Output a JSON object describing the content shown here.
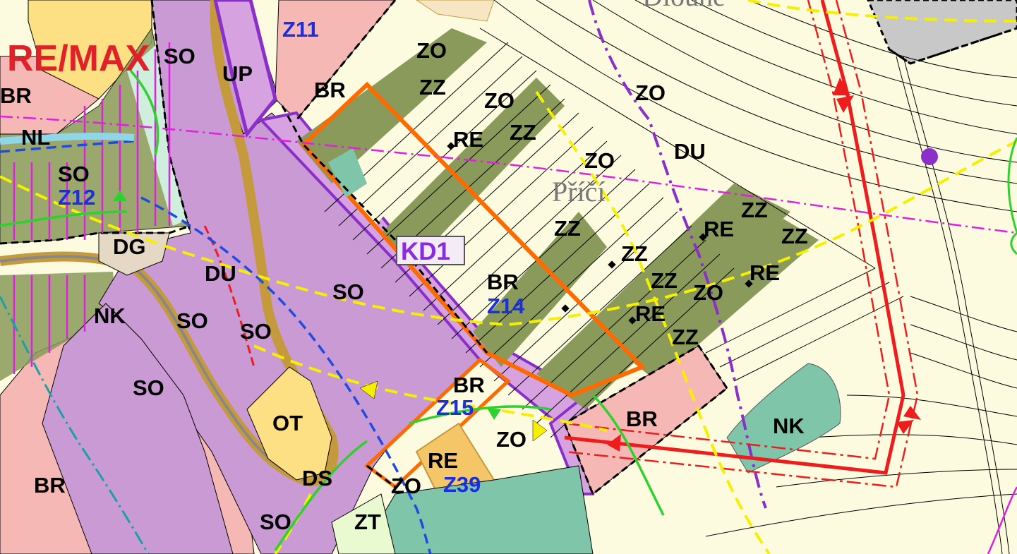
{
  "map": {
    "colors": {
      "background": "#fcfbe0",
      "residential_so": "#c99ad3",
      "housing_br": "#f6b8b4",
      "garden_zz": "#8a9a5b",
      "nature_nk": "#7fc5aa",
      "civic_ot": "#fde084",
      "road_ds": "#c59a3c",
      "boundary_orange": "#ff6a00",
      "boundary_purple": "#8b2fc9",
      "line_red": "#ee1c1c",
      "line_yellow": "#f6f000",
      "line_magenta": "#e020e0",
      "line_blue": "#1f4ce0",
      "line_green": "#2fd12f"
    },
    "logo": "RE/MAX",
    "locality": "Příčí",
    "locality_top": "Dlouhé",
    "corridor_badge": "KD1",
    "labels": [
      {
        "id": "so-1",
        "text": "SO"
      },
      {
        "id": "br-1",
        "text": "BR"
      },
      {
        "id": "nl-1",
        "text": "NL"
      },
      {
        "id": "so-2",
        "text": "SO"
      },
      {
        "id": "z12",
        "text": "Z12",
        "blue": true
      },
      {
        "id": "up",
        "text": "UP"
      },
      {
        "id": "z11",
        "text": "Z11",
        "blue": true
      },
      {
        "id": "br-2",
        "text": "BR"
      },
      {
        "id": "zo-1",
        "text": "ZO"
      },
      {
        "id": "zz-1",
        "text": "ZZ"
      },
      {
        "id": "zo-2",
        "text": "ZO"
      },
      {
        "id": "re-1",
        "text": "RE"
      },
      {
        "id": "zz-2",
        "text": "ZZ"
      },
      {
        "id": "zo-3",
        "text": "ZO"
      },
      {
        "id": "zo-4",
        "text": "ZO"
      },
      {
        "id": "du-1",
        "text": "DU"
      },
      {
        "id": "zz-3",
        "text": "ZZ"
      },
      {
        "id": "re-2",
        "text": "RE"
      },
      {
        "id": "zz-4",
        "text": "ZZ"
      },
      {
        "id": "zz-5",
        "text": "ZZ"
      },
      {
        "id": "zz-6",
        "text": "ZZ"
      },
      {
        "id": "re-3",
        "text": "RE"
      },
      {
        "id": "zz-7",
        "text": "ZZ"
      },
      {
        "id": "zo-5",
        "text": "ZO"
      },
      {
        "id": "re-4",
        "text": "RE"
      },
      {
        "id": "zz-8",
        "text": "ZZ"
      },
      {
        "id": "dg",
        "text": "DG"
      },
      {
        "id": "du-2",
        "text": "DU"
      },
      {
        "id": "so-3",
        "text": "SO"
      },
      {
        "id": "nk-1",
        "text": "NK"
      },
      {
        "id": "so-4",
        "text": "SO"
      },
      {
        "id": "so-5",
        "text": "SO"
      },
      {
        "id": "br-3",
        "text": "BR"
      },
      {
        "id": "z14",
        "text": "Z14",
        "blue": true
      },
      {
        "id": "so-6",
        "text": "SO"
      },
      {
        "id": "br-4",
        "text": "BR"
      },
      {
        "id": "z15",
        "text": "Z15",
        "blue": true
      },
      {
        "id": "ot",
        "text": "OT"
      },
      {
        "id": "zo-6",
        "text": "ZO"
      },
      {
        "id": "br-5",
        "text": "BR"
      },
      {
        "id": "nk-2",
        "text": "NK"
      },
      {
        "id": "re-5",
        "text": "RE"
      },
      {
        "id": "br-6",
        "text": "BR"
      },
      {
        "id": "ds",
        "text": "DS"
      },
      {
        "id": "zo-7",
        "text": "ZO"
      },
      {
        "id": "z39",
        "text": "Z39",
        "blue": true
      },
      {
        "id": "so-7",
        "text": "SO"
      },
      {
        "id": "zt",
        "text": "ZT"
      }
    ]
  }
}
